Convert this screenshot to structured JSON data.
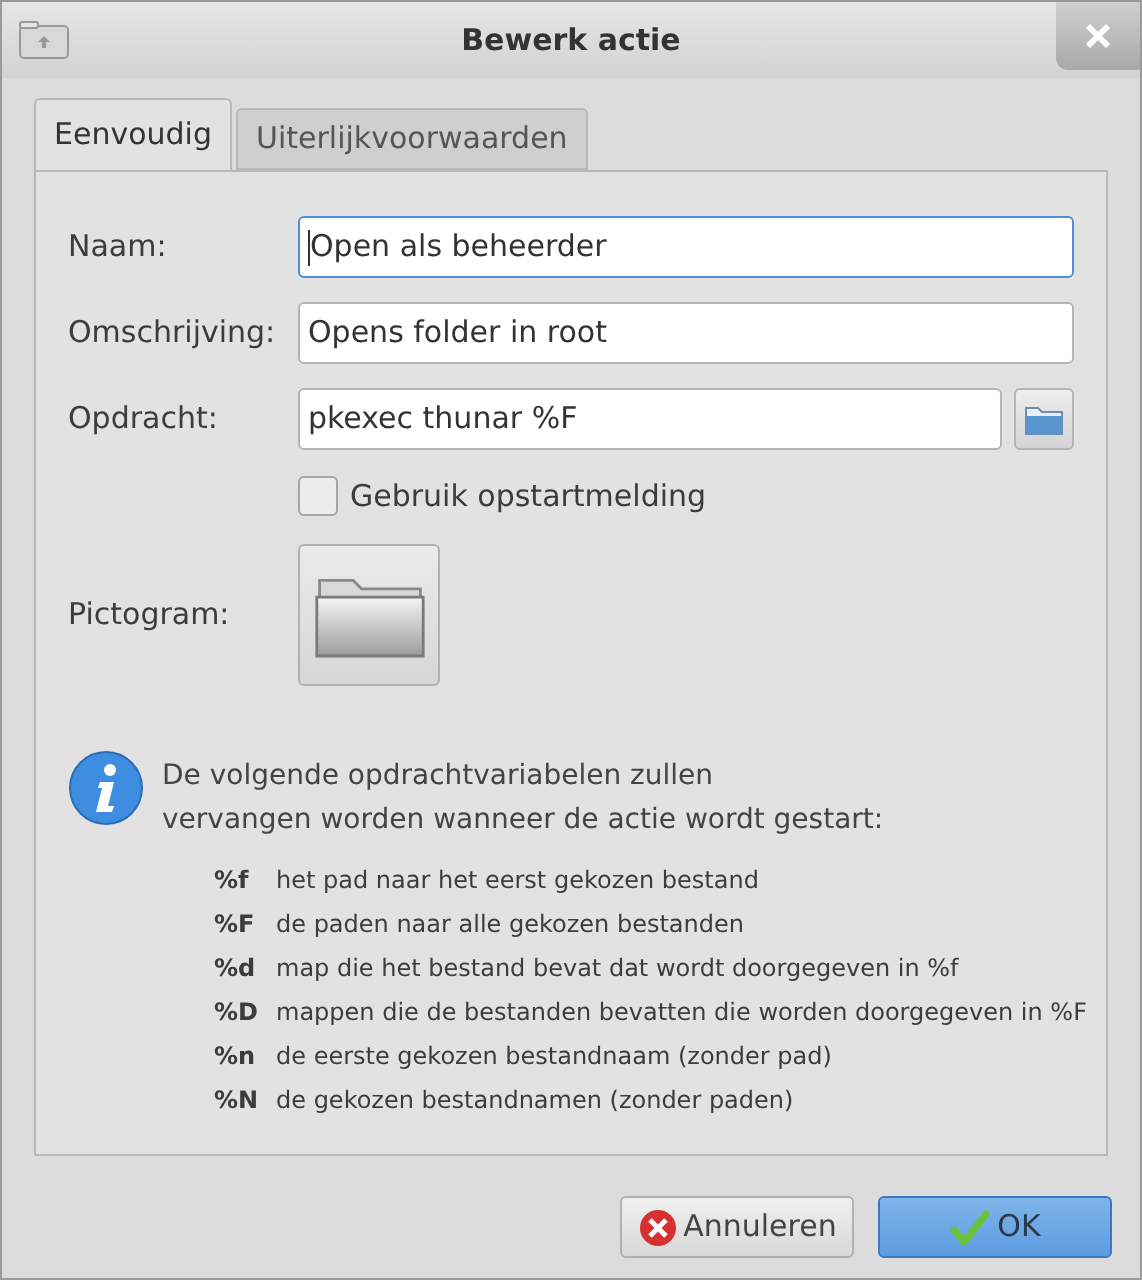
{
  "window": {
    "title": "Bewerk actie"
  },
  "tabs": [
    {
      "label": "Eenvoudig",
      "selected": true
    },
    {
      "label": "Uiterlijkvoorwaarden",
      "selected": false
    }
  ],
  "fields": [
    {
      "label": "Naam:",
      "value": "Open als beheerder",
      "focused": true,
      "browse": false
    },
    {
      "label": "Omschrijving:",
      "value": "Opens folder in root",
      "focused": false,
      "browse": false
    },
    {
      "label": "Opdracht:",
      "value": "pkexec thunar %F",
      "focused": false,
      "browse": true
    }
  ],
  "startup_checkbox": {
    "label": "Gebruik opstartmelding",
    "checked": false
  },
  "icon_field": {
    "label": "Pictogram:"
  },
  "info": {
    "lines": [
      "De volgende opdrachtvariabelen zullen",
      "vervangen worden wanneer de actie wordt gestart:"
    ]
  },
  "variables": [
    {
      "code": "%f",
      "description": "het pad naar het eerst gekozen bestand"
    },
    {
      "code": "%F",
      "description": "de paden naar alle gekozen bestanden"
    },
    {
      "code": "%d",
      "description": "map die het bestand bevat dat wordt doorgegeven in %f"
    },
    {
      "code": "%D",
      "description": "mappen die de bestanden bevatten die worden doorgegeven in %F"
    },
    {
      "code": "%n",
      "description": "de eerste gekozen bestandnaam (zonder pad)"
    },
    {
      "code": "%N",
      "description": "de gekozen bestandnamen (zonder paden)"
    }
  ],
  "buttons": [
    {
      "label": "Annuleren",
      "kind": "cancel"
    },
    {
      "label": "OK",
      "kind": "ok"
    }
  ]
}
